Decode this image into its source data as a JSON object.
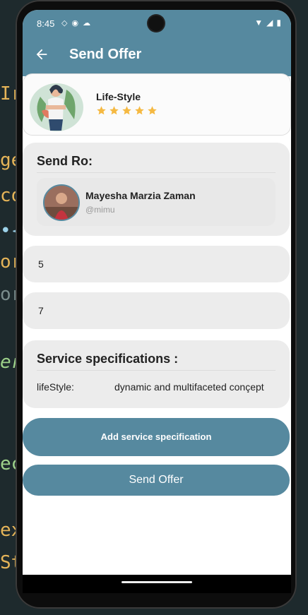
{
  "status": {
    "time": "8:45"
  },
  "appbar": {
    "title": "Send Offer"
  },
  "category": {
    "title": "Life-Style",
    "stars": 5,
    "star_color": "#f5b942"
  },
  "send_to": {
    "title": "Send Ro:",
    "user": {
      "name": "Mayesha Marzia Zaman",
      "handle": "@mimu"
    }
  },
  "fields": {
    "first": "5",
    "second": "7"
  },
  "specs": {
    "title": "Service specifications :",
    "items": [
      {
        "key": "lifeStyle:",
        "value": "dynamic and multifaceted conçept"
      }
    ]
  },
  "buttons": {
    "add_spec": "Add service specification",
    "send_offer": "Send Offer"
  },
  "colors": {
    "primary": "#56899f",
    "card": "#ececec"
  },
  "background_code": [
    "Ir",
    "ge",
    "co",
    "•{",
    "or",
    "or",
    "er",
    "ec",
    "ex",
    "St"
  ]
}
